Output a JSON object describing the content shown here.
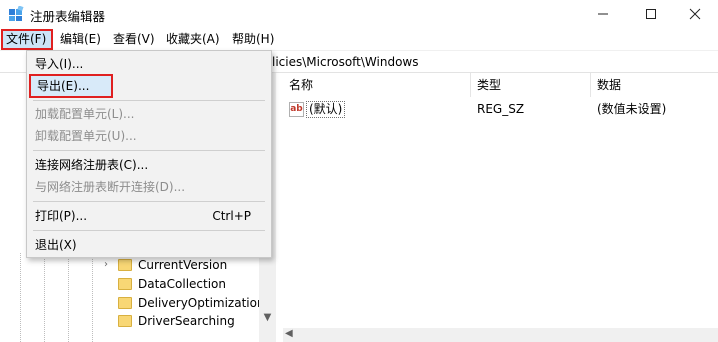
{
  "window": {
    "title": "注册表编辑器"
  },
  "menubar": {
    "items": [
      {
        "label": "文件(F)"
      },
      {
        "label": "编辑(E)"
      },
      {
        "label": "查看(V)"
      },
      {
        "label": "收藏夹(A)"
      },
      {
        "label": "帮助(H)"
      }
    ]
  },
  "address": {
    "path": "licies\\Microsoft\\Windows"
  },
  "file_menu": {
    "import": "导入(I)...",
    "export": "导出(E)...",
    "load_hive": "加载配置单元(L)...",
    "unload_hive": "卸载配置单元(U)...",
    "connect": "连接网络注册表(C)...",
    "disconnect": "与网络注册表断开连接(D)...",
    "print": "打印(P)...",
    "print_shortcut": "Ctrl+P",
    "exit": "退出(X)"
  },
  "tree": {
    "items": [
      {
        "label": "CurrentVersion",
        "expander": "›"
      },
      {
        "label": "DataCollection",
        "expander": ""
      },
      {
        "label": "DeliveryOptimization",
        "expander": ""
      },
      {
        "label": "DriverSearching",
        "expander": ""
      }
    ]
  },
  "list": {
    "headers": {
      "name": "名称",
      "type": "类型",
      "data": "数据"
    },
    "rows": [
      {
        "name": "(默认)",
        "type": "REG_SZ",
        "data": "(数值未设置)",
        "icon": "string-value-icon"
      }
    ]
  },
  "icons": {
    "minimize": "minimize-icon",
    "maximize": "maximize-icon",
    "close": "close-icon"
  },
  "colors": {
    "highlight_border": "#e02020",
    "menu_selected_bg": "#cce4f7",
    "folder": "#f8d775"
  }
}
